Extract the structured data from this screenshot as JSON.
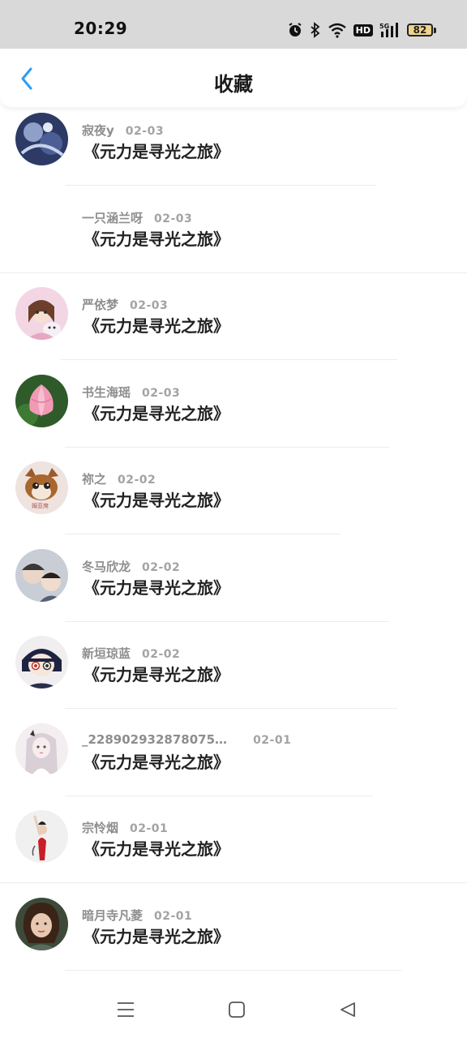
{
  "status_bar": {
    "time": "20:29",
    "battery": "82",
    "network_label": "HD",
    "icons": [
      "alarm-icon",
      "bluetooth-icon",
      "wifi-icon",
      "hd-icon",
      "signal-5g-icon",
      "battery-icon"
    ]
  },
  "header": {
    "title": "收藏",
    "back_icon": "chevron-left-icon",
    "accent_color": "#2f9df4"
  },
  "favorites": [
    {
      "user": "寂夜y",
      "date": "02-03",
      "title": "《元力是寻光之旅》",
      "has_avatar": true
    },
    {
      "user": "一只涵兰呀",
      "date": "02-03",
      "title": "《元力是寻光之旅》",
      "has_avatar": false
    },
    {
      "user": "严依梦",
      "date": "02-03",
      "title": "《元力是寻光之旅》",
      "has_avatar": true
    },
    {
      "user": "书生海瑶",
      "date": "02-03",
      "title": "《元力是寻光之旅》",
      "has_avatar": true
    },
    {
      "user": "祢之",
      "date": "02-02",
      "title": "《元力是寻光之旅》",
      "has_avatar": true
    },
    {
      "user": "冬马欣龙",
      "date": "02-02",
      "title": "《元力是寻光之旅》",
      "has_avatar": true
    },
    {
      "user": "新垣琼蓝",
      "date": "02-02",
      "title": "《元力是寻光之旅》",
      "has_avatar": true
    },
    {
      "user": "_228902932878075…",
      "date": "02-01",
      "title": "《元力是寻光之旅》",
      "has_avatar": true
    },
    {
      "user": "宗怜烟",
      "date": "02-01",
      "title": "《元力是寻光之旅》",
      "has_avatar": true
    },
    {
      "user": "暗月寺凡菱",
      "date": "02-01",
      "title": "《元力是寻光之旅》",
      "has_avatar": true
    }
  ],
  "nav_bar": {
    "icons": [
      "menu-icon",
      "home-icon",
      "back-triangle-icon"
    ]
  }
}
